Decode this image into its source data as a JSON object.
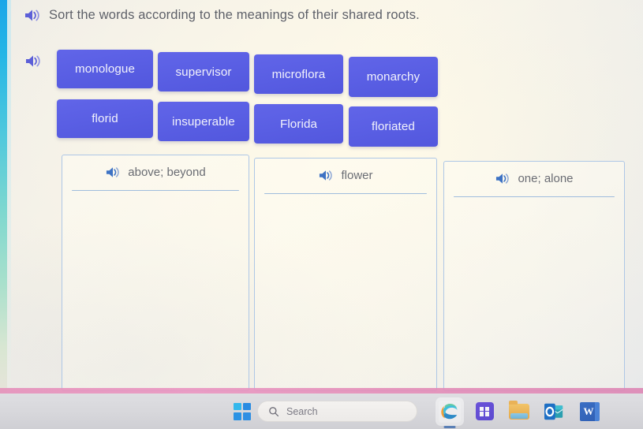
{
  "exercise": {
    "prompt": "Sort the words according to the meanings of their shared roots.",
    "prompt_audio_icon": "speaker-icon",
    "tiles_audio_icon": "speaker-icon",
    "word_tiles": [
      {
        "label": "monologue"
      },
      {
        "label": "supervisor"
      },
      {
        "label": "microflora"
      },
      {
        "label": "monarchy"
      },
      {
        "label": "florid"
      },
      {
        "label": "insuperable"
      },
      {
        "label": "Florida"
      },
      {
        "label": "floriated"
      }
    ],
    "categories": [
      {
        "label": "above; beyond",
        "audio_icon": "speaker-icon"
      },
      {
        "label": "flower",
        "audio_icon": "speaker-icon"
      },
      {
        "label": "one; alone",
        "audio_icon": "speaker-icon"
      }
    ],
    "colors": {
      "tile_fill": "#5a5fe4",
      "tile_text": "#f2f2fb",
      "zone_border": "#aec7e6",
      "prompt_text": "#5d5f66",
      "speaker_icon": "#5c5fd8",
      "pink_divider": "#e58fba",
      "left_strip": "#25b6e6"
    }
  },
  "taskbar": {
    "start_button": "start-button",
    "search": {
      "placeholder": "Search",
      "icon": "search-icon"
    },
    "apps": [
      {
        "name": "Microsoft Edge",
        "icon": "edge-icon",
        "active": true
      },
      {
        "name": "Microsoft Store",
        "icon": "store-icon",
        "active": false
      },
      {
        "name": "File Explorer",
        "icon": "folder-icon",
        "active": false
      },
      {
        "name": "Outlook",
        "icon": "outlook-icon",
        "active": false
      },
      {
        "name": "Word",
        "icon": "word-icon",
        "letter": "W",
        "active": false
      }
    ]
  }
}
